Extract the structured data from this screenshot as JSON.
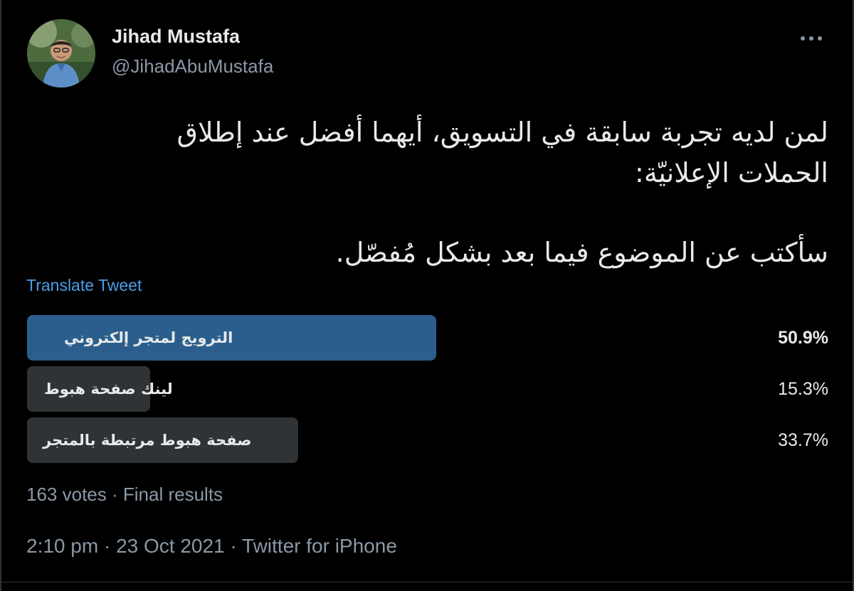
{
  "author": {
    "name": "Jihad Mustafa",
    "handle": "@JihadAbuMustafa",
    "avatar_icon": "user-avatar"
  },
  "more_icon": "more-horizontal-icon",
  "tweet": {
    "lines": [
      "لمن لديه تجربة سابقة في التسويق، أيهما أفضل عند إطلاق",
      "الحملات الإعلانيّة:",
      "سأكتب عن الموضوع فيما بعد بشكل مُفصّل."
    ],
    "translate_label": "Translate Tweet"
  },
  "poll": {
    "options": [
      {
        "label": "الترويج لمتجر إلكتروني",
        "percent_text": "50.9%",
        "percent": 50.9,
        "winner": true
      },
      {
        "label": "لينك صفحة هبوط",
        "percent_text": "15.3%",
        "percent": 15.3,
        "winner": false
      },
      {
        "label": "صفحة هبوط مرتبطة بالمتجر",
        "percent_text": "33.7%",
        "percent": 33.7,
        "winner": false
      }
    ],
    "votes_text": "163 votes",
    "separator": "·",
    "status_text": "Final results"
  },
  "meta": {
    "time": "2:10 pm",
    "date": "23 Oct 2021",
    "source": "Twitter for iPhone",
    "separator": "·"
  },
  "colors": {
    "background": "#000000",
    "text": "#e7e9ea",
    "muted": "#8b98a5",
    "link": "#4a9ee8",
    "winner_bar": "#2b5e8c",
    "bar": "#2f3336"
  }
}
